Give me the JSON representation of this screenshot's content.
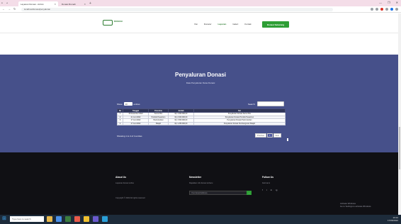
{
  "browser": {
    "tabs": [
      {
        "label": "Layanan Donasi - Admin",
        "active": true
      },
      {
        "label": "Donasi Rumah",
        "active": false
      }
    ],
    "url": "localhost/donasi/penyaluran",
    "window_controls": [
      "—",
      "❐",
      "✕"
    ]
  },
  "header": {
    "logo_text": "DONASI",
    "nav": [
      "Visi",
      "Donatur",
      "Laporan",
      "Galeri",
      "Kontak"
    ],
    "active_nav": "Laporan",
    "donate_button": "Donasi Sekarang"
  },
  "donasi": {
    "title": "Penyaluran Donasi",
    "subtitle": "Data Penyaluran Dana Donasi",
    "show_label": "Show",
    "entries_value": "10",
    "entries_label": "entries",
    "search_label": "Search:",
    "table": {
      "headers": [
        "No",
        "Tanggal",
        "Penerima",
        "Jumlah",
        "Ket"
      ],
      "rows": [
        [
          "1",
          "15 Desember 2022",
          "Sumur Bor",
          "Rp 1.000.000,00",
          "Penyaluran Donasi Sumur Bor"
        ],
        [
          "2",
          "21 Juni 2022",
          "Pondok Pesantren",
          "Rp 2.000.000,00",
          "Penyaluran Donasi Pondok Pesantren"
        ],
        [
          "3",
          "17 Juni 2022",
          "Panti Asuhan",
          "Rp 1.500.000,00",
          "Penyaluran Donasi Panti Asuhan"
        ],
        [
          "4",
          "17 Juni 2022",
          "Masjid",
          "Rp 1.250.000,00",
          "Penyaluran Donasi Pembangunan Masjid"
        ]
      ]
    },
    "showing": "Showing 1 to 4 of 4 entries",
    "pager": [
      "Previous",
      "1",
      "Next"
    ]
  },
  "footer": {
    "about_title": "About Us",
    "about_text": "Layanan donasi online",
    "newsletter_title": "Newsletter",
    "newsletter_text": "Dapatkan info donasi terbaru",
    "newsletter_placeholder": "Your Email Address",
    "newsletter_button": "→",
    "follow_title": "Follow Us",
    "follow_text": "Ikuti kami",
    "socials": [
      "f",
      "t",
      "in",
      "ig"
    ],
    "copyright": "Copyright © 2022 All rights reserved",
    "activate_line1": "Activate Windows",
    "activate_line2": "Go to Settings to activate Windows."
  },
  "taskbar": {
    "search_placeholder": "Type here to search",
    "time": "10:24",
    "date": "17/06/2022"
  }
}
